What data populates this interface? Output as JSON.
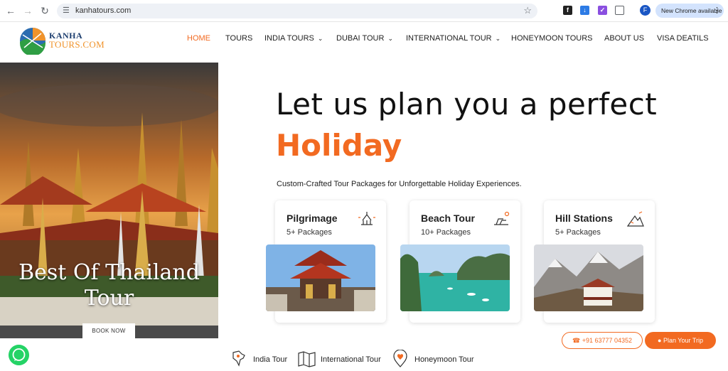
{
  "browser": {
    "url": "kanhatours.com",
    "update_label": "New Chrome available",
    "profile_initial": "F"
  },
  "logo": {
    "line1": "KANHA",
    "line2": "TOURS.COM"
  },
  "nav": {
    "items": [
      {
        "label": "HOME",
        "active": true
      },
      {
        "label": "TOURS"
      },
      {
        "label": "INDIA TOURS",
        "dropdown": true
      },
      {
        "label": "DUBAI TOUR",
        "dropdown": true
      },
      {
        "label": "INTERNATIONAL TOUR",
        "dropdown": true
      },
      {
        "label": "HONEYMOON TOURS"
      },
      {
        "label": "ABOUT US"
      },
      {
        "label": "VISA DEATILS"
      }
    ]
  },
  "hero_banner": {
    "title_line1": "Best Of Thailand",
    "title_line2": "Tour",
    "button": "BOOK NOW"
  },
  "hero": {
    "headline": "Let us plan you a perfect",
    "highlight": "Holiday",
    "tagline": "Custom-Crafted Tour Packages for Unforgettable Holiday Experiences."
  },
  "cards": [
    {
      "title": "Pilgrimage",
      "count": "5+ Packages",
      "icon": "temple-icon"
    },
    {
      "title": "Beach Tour",
      "count": "10+ Packages",
      "icon": "beach-chair-icon"
    },
    {
      "title": "Hill Stations",
      "count": "5+ Packages",
      "icon": "mountain-climb-icon"
    }
  ],
  "cta": {
    "phone": "+91 63777 04352",
    "plan": "Plan Your Trip"
  },
  "bottom_links": [
    {
      "label": "India Tour",
      "icon": "india-map-icon"
    },
    {
      "label": "International Tour",
      "icon": "world-map-icon"
    },
    {
      "label": "Honeymoon Tour",
      "icon": "heart-pin-icon"
    }
  ],
  "colors": {
    "accent": "#f26a21",
    "logo_blue": "#1c3d6e",
    "logo_orange": "#f0932b",
    "whatsapp": "#25d366"
  }
}
